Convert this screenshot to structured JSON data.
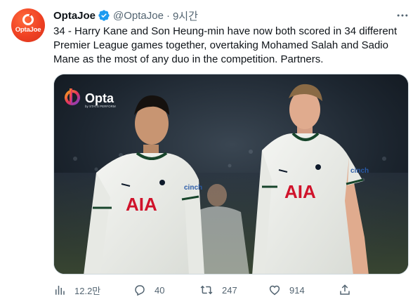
{
  "author": {
    "display_name": "OptaJoe",
    "handle": "@OptaJoe",
    "timestamp": "9시간",
    "avatar_text": "OptaJoe",
    "verified": true
  },
  "tweet": {
    "text": "34 - Harry Kane and Son Heung-min have now both scored in 34 different Premier League games together, overtaking Mohamed Salah and Sadio Mane as the most of any duo in the competition. Partners."
  },
  "media": {
    "logo_text": "Opta",
    "logo_subtext": "by STATS PERFORM",
    "shirt_sponsor": "AIA",
    "sleeve_sponsor": "cinch"
  },
  "actions": {
    "views": "12.2만",
    "replies": "40",
    "retweets": "247",
    "likes": "914"
  },
  "icons": {
    "verified": "verified-badge-icon",
    "more": "more-options-icon",
    "views": "analytics-icon",
    "reply": "reply-icon",
    "retweet": "retweet-icon",
    "like": "heart-icon",
    "share": "share-icon"
  },
  "colors": {
    "accent": "#1d9bf0",
    "avatar_bg": "#ef4123",
    "secondary_text": "#536471",
    "border": "#cfd9de"
  }
}
